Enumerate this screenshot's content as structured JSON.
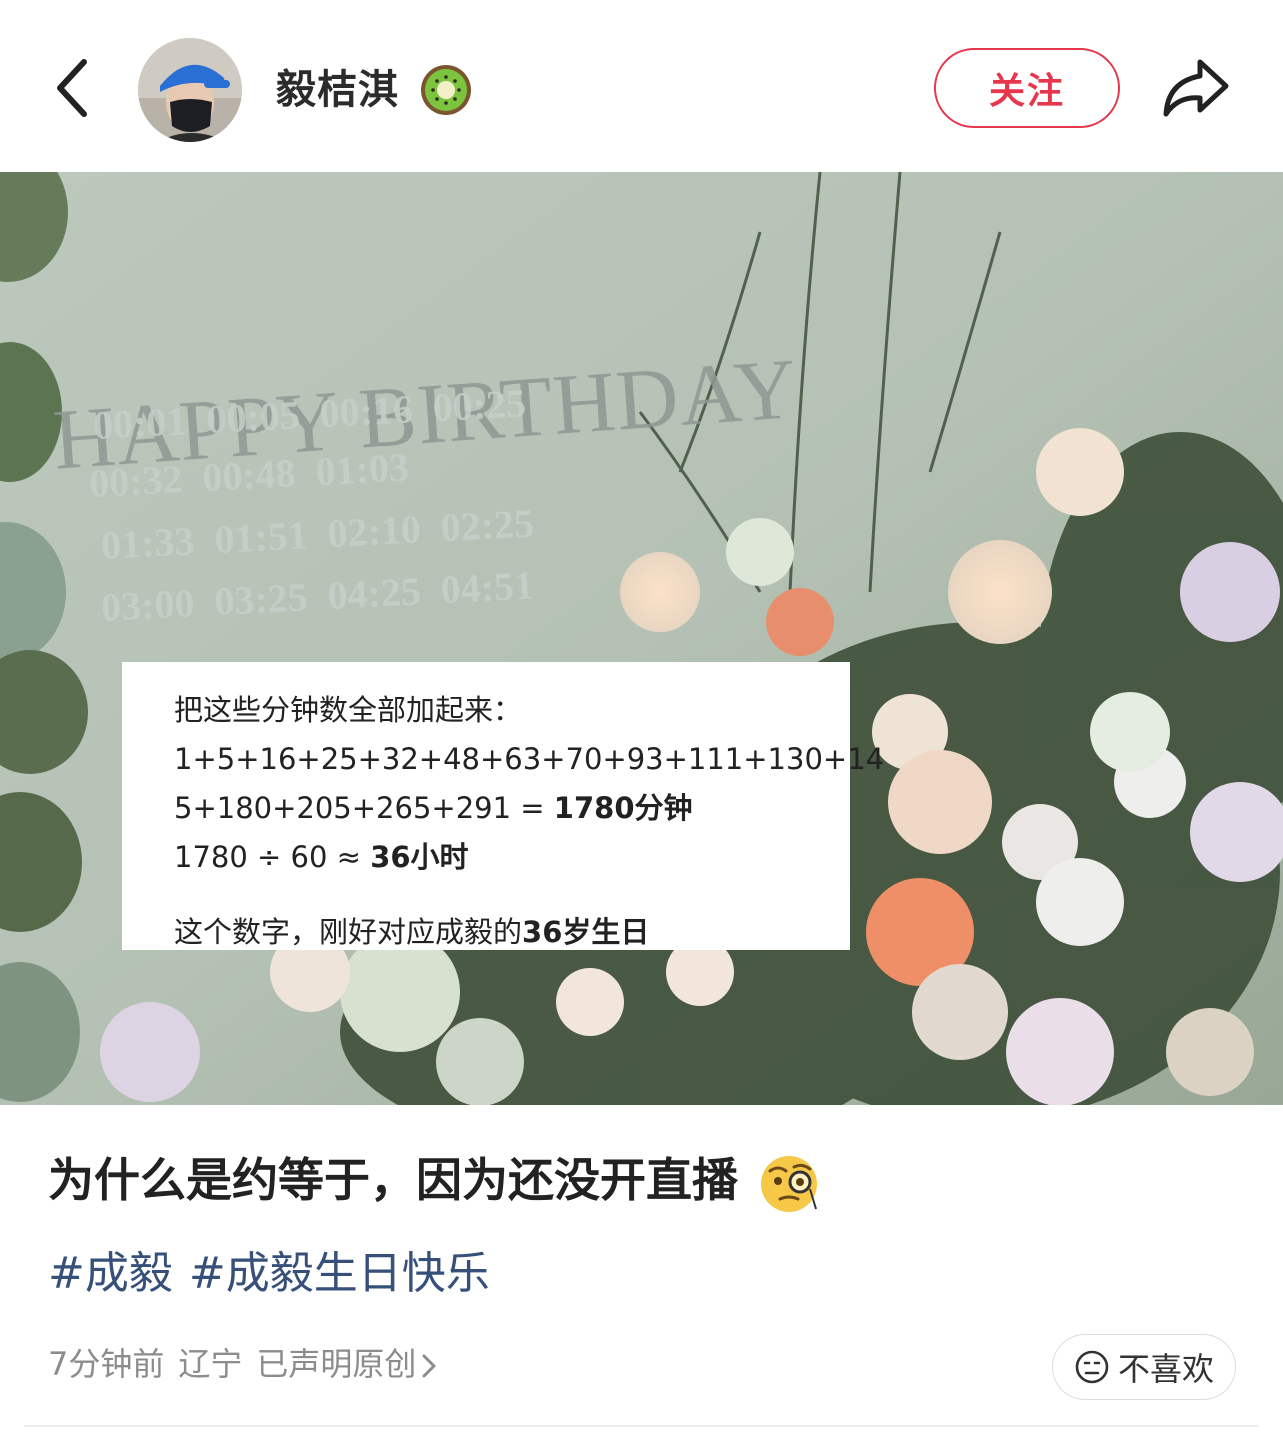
{
  "header": {
    "username": "毅桔淇",
    "follow_label": "关注",
    "badge_icon": "kiwi-fruit-icon",
    "accent_color": "#e8364c"
  },
  "photo": {
    "birthday_text": "HAPPY BIRTHDAY",
    "time_rows": [
      "00:01  00:05  00:16  00:25",
      "00:32  00:48  01:03",
      "01:33  01:51  02:10  02:25",
      "03:00  03:25  04:25  04:51"
    ]
  },
  "card": {
    "line1": "把这些分钟数全部加起来：",
    "line2": "1+5+16+25+32+48+63+70+93+111+130+14",
    "line3_prefix": "5+180+205+265+291 = ",
    "line3_bold": "1780分钟",
    "line4_prefix": "1780 ÷ 60 ≈ ",
    "line4_bold": "36小时",
    "line5_prefix": "这个数字，刚好对应成毅的",
    "line5_bold": "36岁生日"
  },
  "post": {
    "text": "为什么是约等于，因为还没开直播",
    "emoji": "face-with-monocle-icon",
    "tags": [
      "#成毅",
      "#成毅生日快乐"
    ],
    "tag_color": "#36507a"
  },
  "meta": {
    "time": "7分钟前",
    "location": "辽宁",
    "original": "已声明原创",
    "dislike_label": "不喜欢"
  }
}
